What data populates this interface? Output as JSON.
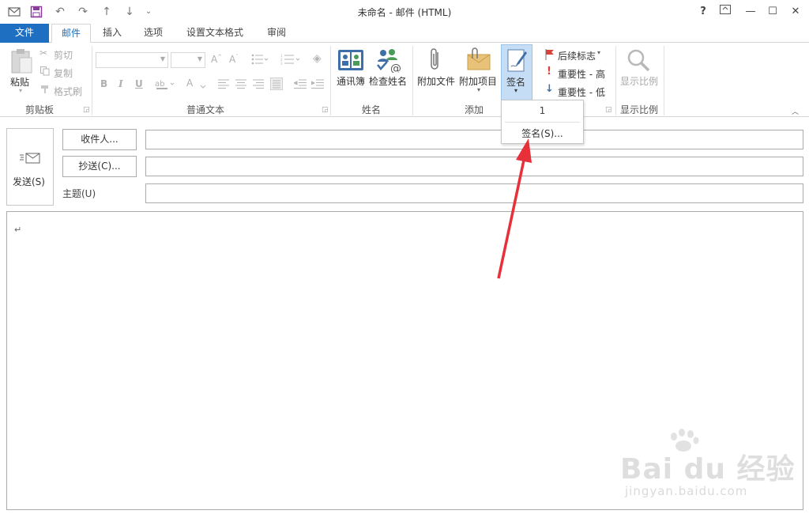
{
  "window": {
    "title": "未命名 - 邮件 (HTML)",
    "help_label": "?",
    "minimize_label": "—",
    "maximize_label": "☐",
    "close_label": "✕"
  },
  "qat": {
    "undo_glyph": "↶",
    "redo_glyph": "↷",
    "up_glyph": "↑",
    "down_glyph": "↓",
    "more_glyph": "⌄"
  },
  "tabs": [
    {
      "label": "文件"
    },
    {
      "label": "邮件"
    },
    {
      "label": "插入"
    },
    {
      "label": "选项"
    },
    {
      "label": "设置文本格式"
    },
    {
      "label": "审阅"
    }
  ],
  "ribbon": {
    "clipboard": {
      "paste": "粘贴",
      "cut": "剪切",
      "copy": "复制",
      "format_painter": "格式刷",
      "group": "剪贴板"
    },
    "basic_text": {
      "group": "普通文本",
      "bold": "B",
      "italic": "I",
      "underline": "U",
      "font_color": "A"
    },
    "names": {
      "address_book": "通讯簿",
      "check_names": "检查姓名",
      "group": "姓名"
    },
    "include": {
      "attach_file": "附加文件",
      "attach_item": "附加项目",
      "signature": "签名",
      "group": "添加"
    },
    "tags": {
      "follow_up": "后续标志",
      "high_importance": "重要性 - 高",
      "low_importance": "重要性 - 低"
    },
    "zoom": {
      "zoom": "显示比例",
      "group": "显示比例"
    }
  },
  "signature_menu": {
    "item_1": "1",
    "item_signatures": "签名(S)..."
  },
  "compose": {
    "send": "发送(S)",
    "to": "收件人...",
    "cc": "抄送(C)...",
    "subject_label": "主题(U)",
    "to_value": "",
    "cc_value": "",
    "subject_value": "",
    "paragraph_mark": "↵"
  },
  "watermark": {
    "brand": "Bai du 经验",
    "url": "jingyan.baidu.com"
  },
  "colors": {
    "accent": "#1e6fc1",
    "arrow": "#e8303a",
    "signature_highlight": "#c5def5"
  }
}
